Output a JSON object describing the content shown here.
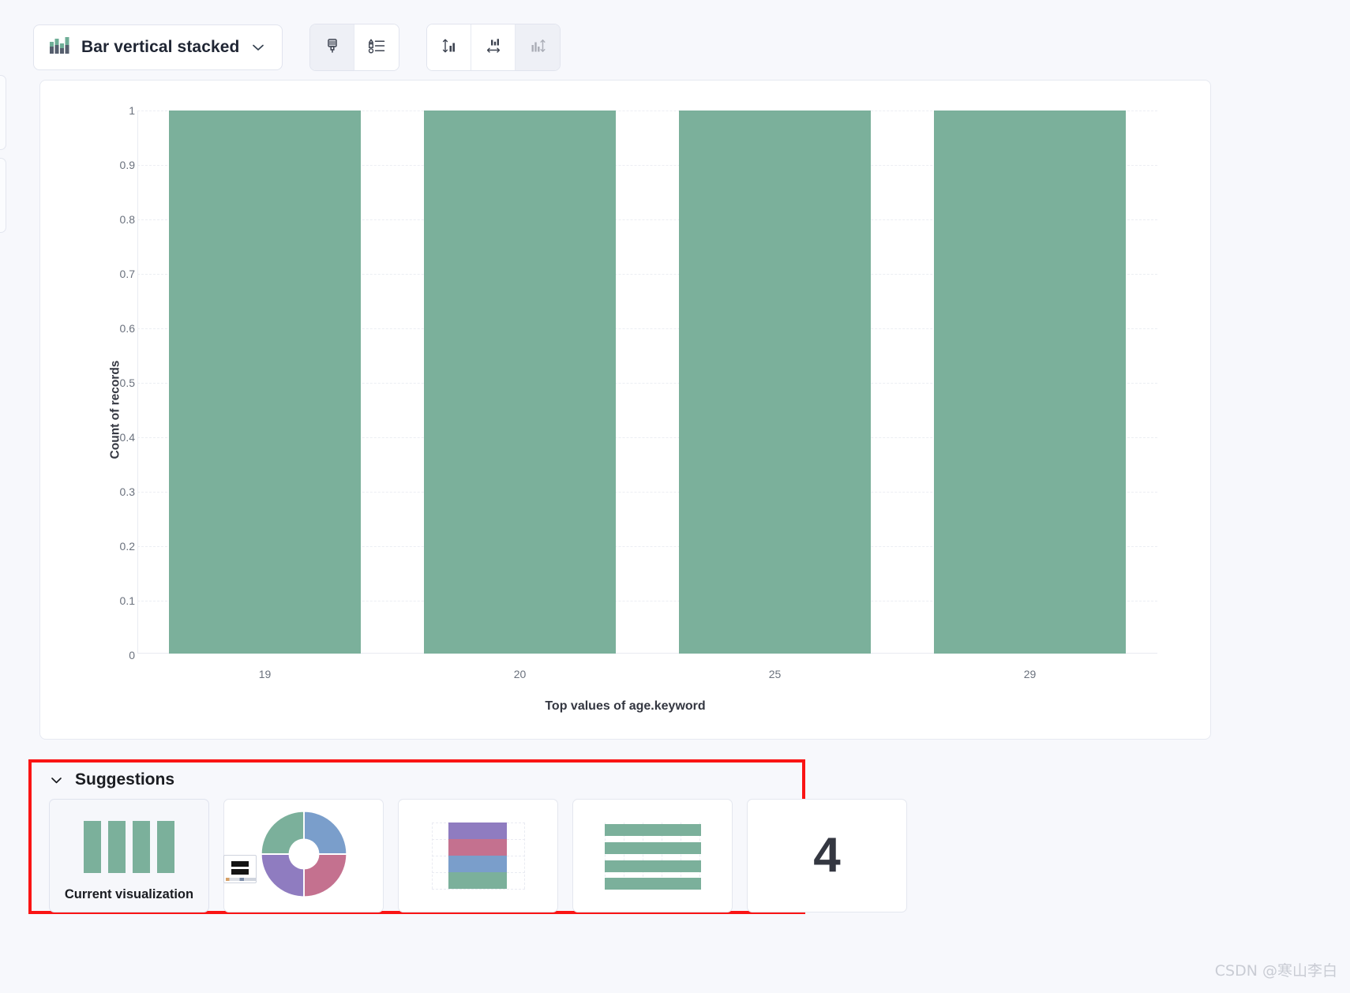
{
  "toolbar": {
    "chart_type": {
      "label": "Bar vertical stacked",
      "icon": "stacked-bar-icon",
      "caret_icon": "chevron-down-icon"
    },
    "style_group": [
      {
        "name": "paintbrush-icon",
        "title": "Appearance",
        "active": true
      },
      {
        "name": "legend-list-icon",
        "title": "Legend",
        "active": false
      }
    ],
    "orientation_group": [
      {
        "name": "vertical-bar-axis-icon",
        "title": "Vertical",
        "active": false,
        "disabled": false
      },
      {
        "name": "horizontal-bar-axis-icon",
        "title": "Horizontal",
        "active": false,
        "disabled": false
      },
      {
        "name": "flip-axis-icon",
        "title": "Flip axes",
        "active": false,
        "disabled": true
      }
    ]
  },
  "chart_data": {
    "type": "bar",
    "title": "",
    "categories": [
      "19",
      "20",
      "25",
      "29"
    ],
    "values": [
      1,
      1,
      1,
      1
    ],
    "series": [
      {
        "name": "Count of records",
        "values": [
          1,
          1,
          1,
          1
        ]
      }
    ],
    "xlabel": "Top values of age.keyword",
    "ylabel": "Count of records",
    "ylim": [
      0,
      1
    ],
    "yticks": [
      "1",
      "0.9",
      "0.8",
      "0.7",
      "0.6",
      "0.5",
      "0.4",
      "0.3",
      "0.2",
      "0.1",
      "0"
    ],
    "ytick_values": [
      1,
      0.9,
      0.8,
      0.7,
      0.6,
      0.5,
      0.4,
      0.3,
      0.2,
      0.1,
      0
    ],
    "grid": true,
    "legend": "none",
    "bar_color": "#7bb09b"
  },
  "suggestions": {
    "title": "Suggestions",
    "collapse_icon": "chevron-down-icon",
    "highlight_color": "#fa1414",
    "cards": [
      {
        "name": "current-visualization",
        "preview": "vertical-bars",
        "label": "Current visualization",
        "selected": true
      },
      {
        "name": "donut-chart",
        "preview": "donut",
        "label": "",
        "selected": false
      },
      {
        "name": "stacked-bar-chart",
        "preview": "stacked-bar",
        "label": "",
        "selected": false
      },
      {
        "name": "horizontal-bar-chart",
        "preview": "horizontal-bars",
        "label": "",
        "selected": false
      },
      {
        "name": "metric",
        "preview": "metric",
        "label": "",
        "value": "4",
        "selected": false
      }
    ],
    "palette": {
      "green": "#7bb09b",
      "blue": "#7a9ecb",
      "rose": "#c4718f",
      "purple": "#8f7cc0"
    }
  },
  "watermark": "CSDN @寒山李白"
}
